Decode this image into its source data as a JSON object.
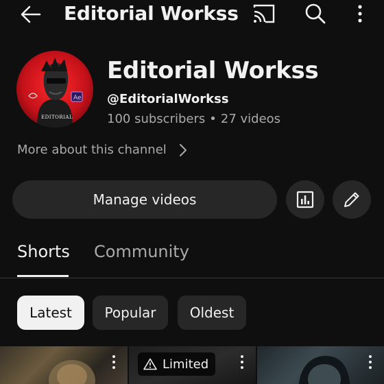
{
  "header": {
    "title": "Editorial Workss",
    "icons": [
      "back-arrow-icon",
      "cast-icon",
      "search-icon",
      "more-vert-icon"
    ]
  },
  "channel": {
    "name": "Editorial Workss",
    "handle": "@EditorialWorkss",
    "subscribers": "100 subscribers",
    "separator": "•",
    "videos": "27 videos",
    "avatar_text": "EDITORIAL",
    "avatar_badge": "Ae",
    "more_about": "More about this channel"
  },
  "actions": {
    "manage_videos": "Manage videos",
    "icons": [
      "analytics-icon",
      "edit-pencil-icon"
    ]
  },
  "tabs": [
    {
      "label": "Shorts",
      "selected": true
    },
    {
      "label": "Community",
      "selected": false
    }
  ],
  "chips": [
    {
      "label": "Latest",
      "selected": true
    },
    {
      "label": "Popular",
      "selected": false
    },
    {
      "label": "Oldest",
      "selected": false
    }
  ],
  "shorts": [
    {
      "badge": ""
    },
    {
      "badge": "Limited"
    },
    {
      "badge": ""
    }
  ],
  "colors": {
    "background": "#0f0f0f",
    "surface": "#272727",
    "text_primary": "#f1f1f1",
    "text_secondary": "#aaaaaa",
    "avatar_red": "#d4141c"
  }
}
